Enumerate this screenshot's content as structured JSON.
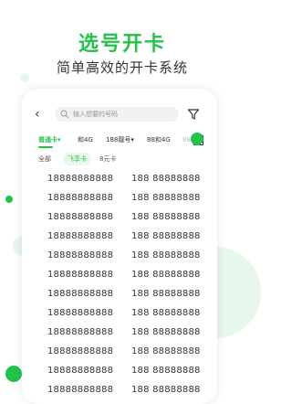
{
  "header": {
    "title": "选号开卡",
    "subtitle": "简单高效的开卡系统"
  },
  "colors": {
    "brand": "#23c24b",
    "text": "#333333",
    "muted": "#999999"
  },
  "search": {
    "placeholder": "输入想要的号码"
  },
  "tabs": [
    {
      "label": "普通卡",
      "active": true,
      "dropdown": true
    },
    {
      "label": "和4G",
      "active": false,
      "dropdown": false
    },
    {
      "label": "188靓号",
      "active": false,
      "dropdown": true
    },
    {
      "label": "88和4G",
      "active": false,
      "dropdown": false
    },
    {
      "label": "88",
      "active": false,
      "dropdown": false
    }
  ],
  "chips": [
    {
      "label": "全部",
      "active": false
    },
    {
      "label": "飞享卡",
      "active": true
    },
    {
      "label": "8元卡",
      "active": false
    }
  ],
  "numbers": [
    [
      "18888888888",
      "188 88888888"
    ],
    [
      "18888888888",
      "188 88888888"
    ],
    [
      "18888888888",
      "188 88888888"
    ],
    [
      "18888888888",
      "188 88888888"
    ],
    [
      "18888888888",
      "188 88888888"
    ],
    [
      "18888888888",
      "188 88888888"
    ],
    [
      "18888888888",
      "188 88888888"
    ],
    [
      "18888888888",
      "188 88888888"
    ],
    [
      "18888888888",
      "188 88888888"
    ],
    [
      "18888888888",
      "188 88888888"
    ],
    [
      "18888888888",
      "188 88888888"
    ],
    [
      "18888888888",
      "188 88888888"
    ]
  ]
}
